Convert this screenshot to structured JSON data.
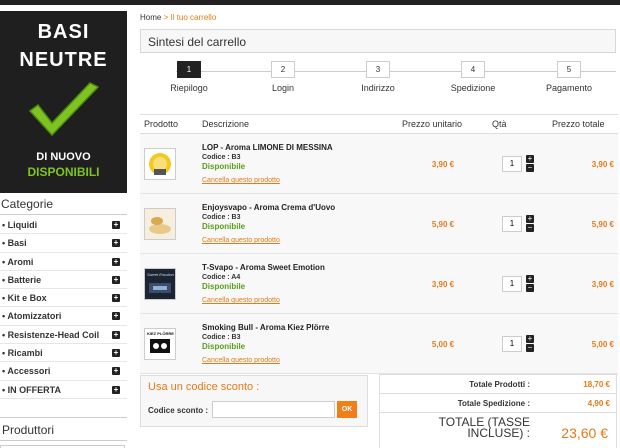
{
  "banner": {
    "line1": "BASI",
    "line2": "NEUTRE",
    "line3": "DI NUOVO",
    "line4": "DISPONIBILI",
    "check_color": "#7ec321"
  },
  "sidebar": {
    "categories_title": "Categorie",
    "categories": [
      {
        "label": "Liquidi"
      },
      {
        "label": "Basi"
      },
      {
        "label": "Aromi"
      },
      {
        "label": "Batterie"
      },
      {
        "label": "Kit e Box"
      },
      {
        "label": "Atomizzatori"
      },
      {
        "label": "Resistenze-Head Coil"
      },
      {
        "label": "Ricambi"
      },
      {
        "label": "Accessori"
      },
      {
        "label": "IN OFFERTA"
      }
    ],
    "producers_title": "Produttori"
  },
  "breadcrumb": {
    "home": "Home",
    "sep": ">",
    "current": "Il tuo carrello"
  },
  "page_title": "Sintesi del carrello",
  "steps": [
    {
      "num": "1",
      "label": "Riepilogo"
    },
    {
      "num": "2",
      "label": "Login"
    },
    {
      "num": "3",
      "label": "Indirizzo"
    },
    {
      "num": "4",
      "label": "Spedizione"
    },
    {
      "num": "5",
      "label": "Pagamento"
    }
  ],
  "table": {
    "headers": {
      "product": "Prodotto",
      "description": "Descrizione",
      "unit_price": "Prezzo unitario",
      "qty": "Qtà",
      "total": "Prezzo totale"
    },
    "rows": [
      {
        "name": "LOP - Aroma LIMONE DI MESSINA",
        "code": "Codice : B3",
        "availability": "Disponibile",
        "remove": "Cancella questo prodotto",
        "unit_price": "3,90 €",
        "qty": "1",
        "total": "3,90 €"
      },
      {
        "name": "Enjoysvapo - Aroma Crema d'Uovo",
        "code": "Codice : B3",
        "availability": "Disponibile",
        "remove": "Cancella questo prodotto",
        "unit_price": "5,90 €",
        "qty": "1",
        "total": "5,90 €"
      },
      {
        "name": "T-Svapo - Aroma Sweet Emotion",
        "code": "Codice : A4",
        "availability": "Disponibile",
        "remove": "Cancella questo prodotto",
        "unit_price": "3,90 €",
        "qty": "1",
        "total": "3,90 €"
      },
      {
        "name": "Smoking Bull - Aroma Kiez Plörre",
        "code": "Codice : B3",
        "availability": "Disponibile",
        "remove": "Cancella questo prodotto",
        "unit_price": "5,00 €",
        "qty": "1",
        "total": "5,00 €"
      }
    ],
    "thumb3_text": "Sweet Emotion",
    "thumb4_text": "KIEZ PLÖRRE"
  },
  "coupon": {
    "title": "Usa un codice sconto :",
    "label": "Codice sconto :",
    "value": "",
    "button": "OK"
  },
  "totals": {
    "products_label": "Totale Prodotti :",
    "products_value": "18,70 €",
    "shipping_label": "Totale Spedizione :",
    "shipping_value": "4,90 €",
    "grand_label": "TOTALE (TASSE INCLUSE) :",
    "grand_value": "23,60 €"
  },
  "colors": {
    "accent": "#e57a18",
    "available": "#5a9e1a"
  }
}
